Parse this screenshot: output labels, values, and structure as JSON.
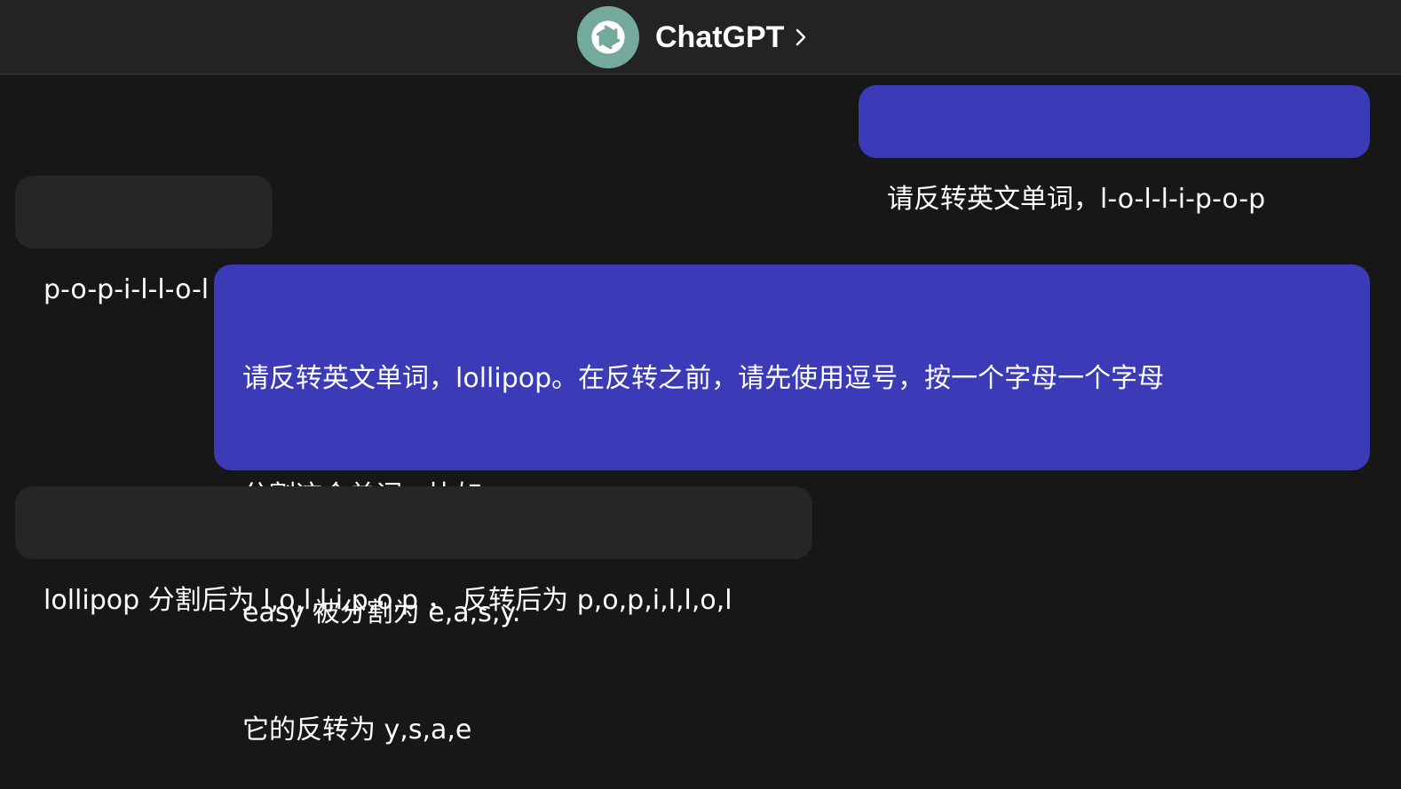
{
  "header": {
    "title": "ChatGPT",
    "logo_icon": "openai-logo-icon",
    "chevron_icon": "chevron-right-icon"
  },
  "colors": {
    "user_bubble": "#3b3bb8",
    "assistant_bubble": "#262626",
    "background": "#171717",
    "header_bg": "#232323",
    "logo_bg": "#74aa9c"
  },
  "messages": [
    {
      "role": "user",
      "lines": [
        "请反转英文单词，l-o-l-l-i-p-o-p"
      ]
    },
    {
      "role": "assistant",
      "lines": [
        "p-o-p-i-l-l-o-l"
      ]
    },
    {
      "role": "user",
      "lines": [
        "请反转英文单词，lollipop。在反转之前，请先使用逗号，按一个字母一个字母",
        "分割这个单词。比如：",
        "easy 被分割为 e,a,s,y.",
        "它的反转为 y,s,a,e"
      ]
    },
    {
      "role": "assistant",
      "lines": [
        "lollipop 分割后为 l,o,l,l,i,p,o,p ， 反转后为 p,o,p,i,l,l,o,l"
      ]
    }
  ]
}
